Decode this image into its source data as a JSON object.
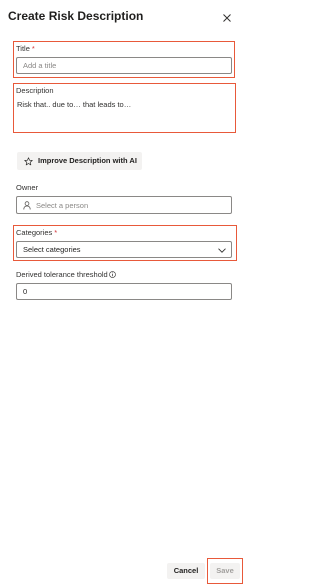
{
  "dialog": {
    "title": "Create Risk Description"
  },
  "fields": {
    "title": {
      "label": "Title",
      "required_mark": "*",
      "placeholder": "Add a title",
      "value": ""
    },
    "description": {
      "label": "Description",
      "value": "Risk that.. due to… that leads to…"
    },
    "improve_button": {
      "label": "Improve Description with AI",
      "icon": "star-icon"
    },
    "owner": {
      "label": "Owner",
      "placeholder": "Select a person",
      "icon": "person-icon"
    },
    "categories": {
      "label": "Categories",
      "required_mark": "*",
      "selected": "Select categories",
      "icon": "chevron-down-icon"
    },
    "tolerance": {
      "label": "Derived tolerance threshold",
      "icon": "info-icon",
      "value": "0"
    }
  },
  "footer": {
    "cancel_label": "Cancel",
    "save_label": "Save"
  },
  "colors": {
    "required": "#d13438",
    "highlight_box": "#e8593a",
    "disabled_text": "#a19f9d",
    "button_bg": "#f3f2f1"
  }
}
